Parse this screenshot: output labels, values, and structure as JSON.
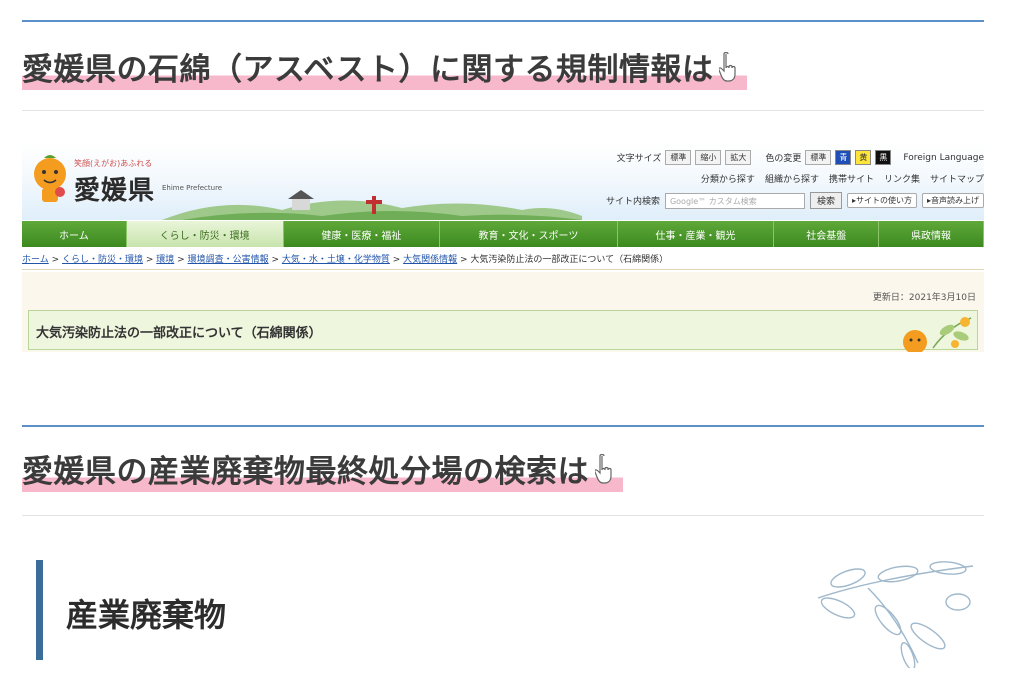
{
  "section1": {
    "heading": "愛媛県の石綿（アスベスト）に関する規制情報は",
    "pointer_icon": "pointing-hand-icon"
  },
  "screenshot": {
    "logo": {
      "tagline": "笑顔(えがお)あふれる",
      "name": "愛媛県",
      "subtitle": "Ehime Prefecture"
    },
    "utility": {
      "font_size_label": "文字サイズ",
      "font_buttons": [
        "標準",
        "縮小",
        "拡大"
      ],
      "color_label": "色の変更",
      "color_buttons": [
        "標準",
        "青",
        "黄",
        "黒"
      ],
      "foreign_language": "Foreign Language",
      "links": [
        "分類から探す",
        "組織から探す",
        "携帯サイト",
        "リンク集",
        "サイトマップ"
      ],
      "site_search_label": "サイト内検索",
      "search_placeholder": "Google™ カスタム検索",
      "search_button": "検索",
      "how_to_use": "▸サイトの使い方",
      "read_aloud": "▸音声読み上げ"
    },
    "nav": [
      "ホーム",
      "くらし・防災・環境",
      "健康・医療・福祉",
      "教育・文化・スポーツ",
      "仕事・産業・観光",
      "社会基盤",
      "県政情報"
    ],
    "breadcrumb": {
      "links": [
        "ホーム",
        "くらし・防災・環境",
        "環境",
        "環境調査・公害情報",
        "大気・水・土壌・化学物質",
        "大気関係情報"
      ],
      "current": "大気汚染防止法の一部改正について（石綿関係）",
      "separator": " > "
    },
    "updated": "更新日：2021年3月10日",
    "page_title": "大気汚染防止法の一部改正について（石綿関係）"
  },
  "section2": {
    "heading": "愛媛県の産業廃棄物最終処分場の検索は",
    "pointer_icon": "pointing-hand-icon"
  },
  "subsection": {
    "title": "産業廃棄物"
  },
  "colors": {
    "accent_blue": "#5b8fc7",
    "highlight_pink": "#f7b8cc",
    "nav_green": "#3c8a1f",
    "bar_blue": "#3b6d9a"
  }
}
